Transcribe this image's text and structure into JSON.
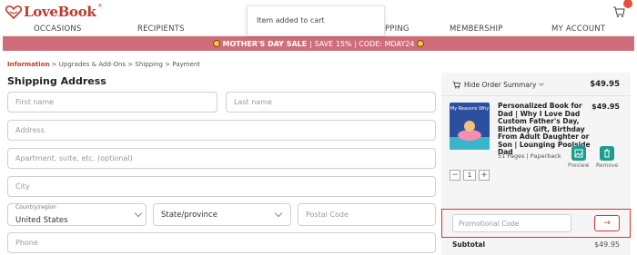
{
  "header": {
    "brand": "LoveBook",
    "brand_tm": "®",
    "cart_icon": "cart-icon"
  },
  "toast": {
    "message": "Item added to cart"
  },
  "nav": {
    "items": [
      "OCCASIONS",
      "RECIPIENTS",
      "PPING",
      "MEMBERSHIP",
      "MY ACCOUNT"
    ]
  },
  "banner": {
    "title": "MOTHER'S DAY SALE",
    "text": "| SAVE 15% | CODE: MDAY24",
    "bg_color": "#cf6e7a"
  },
  "breadcrumb": {
    "active": "Information",
    "rest": " > Upgrades & Add-Ons > Shipping > Payment"
  },
  "shipping": {
    "title": "Shipping Address",
    "first_name_placeholder": "First name",
    "last_name_placeholder": "Last name",
    "address_placeholder": "Address",
    "apartment_placeholder": "Apartment, suite, etc. (optional)",
    "city_placeholder": "City",
    "country_label": "Country/region",
    "country_value": "United States",
    "state_label": "State/province",
    "postal_placeholder": "Postal Code",
    "phone_placeholder": "Phone"
  },
  "summary": {
    "toggle_label": "Hide Order Summary",
    "total": "$49.95",
    "product": {
      "cover_title": "My Reasons Why",
      "name": "Personalized Book for Dad | Why I Love Dad Custom Father's Day, Birthday Gift, Birthday From Adult Daughter or Son | Lounging Poolside Dad",
      "price": "$49.95",
      "meta": "51 Pages | Paperback",
      "quantity": "1",
      "minus": "−",
      "plus": "+",
      "preview_label": "Preview",
      "remove_label": "Remove"
    },
    "promo_placeholder": "Promotional Code",
    "promo_button": "→",
    "subtotal_label": "Subtotal",
    "subtotal_value": "$49.95",
    "accent_color": "#1a9e8f"
  }
}
